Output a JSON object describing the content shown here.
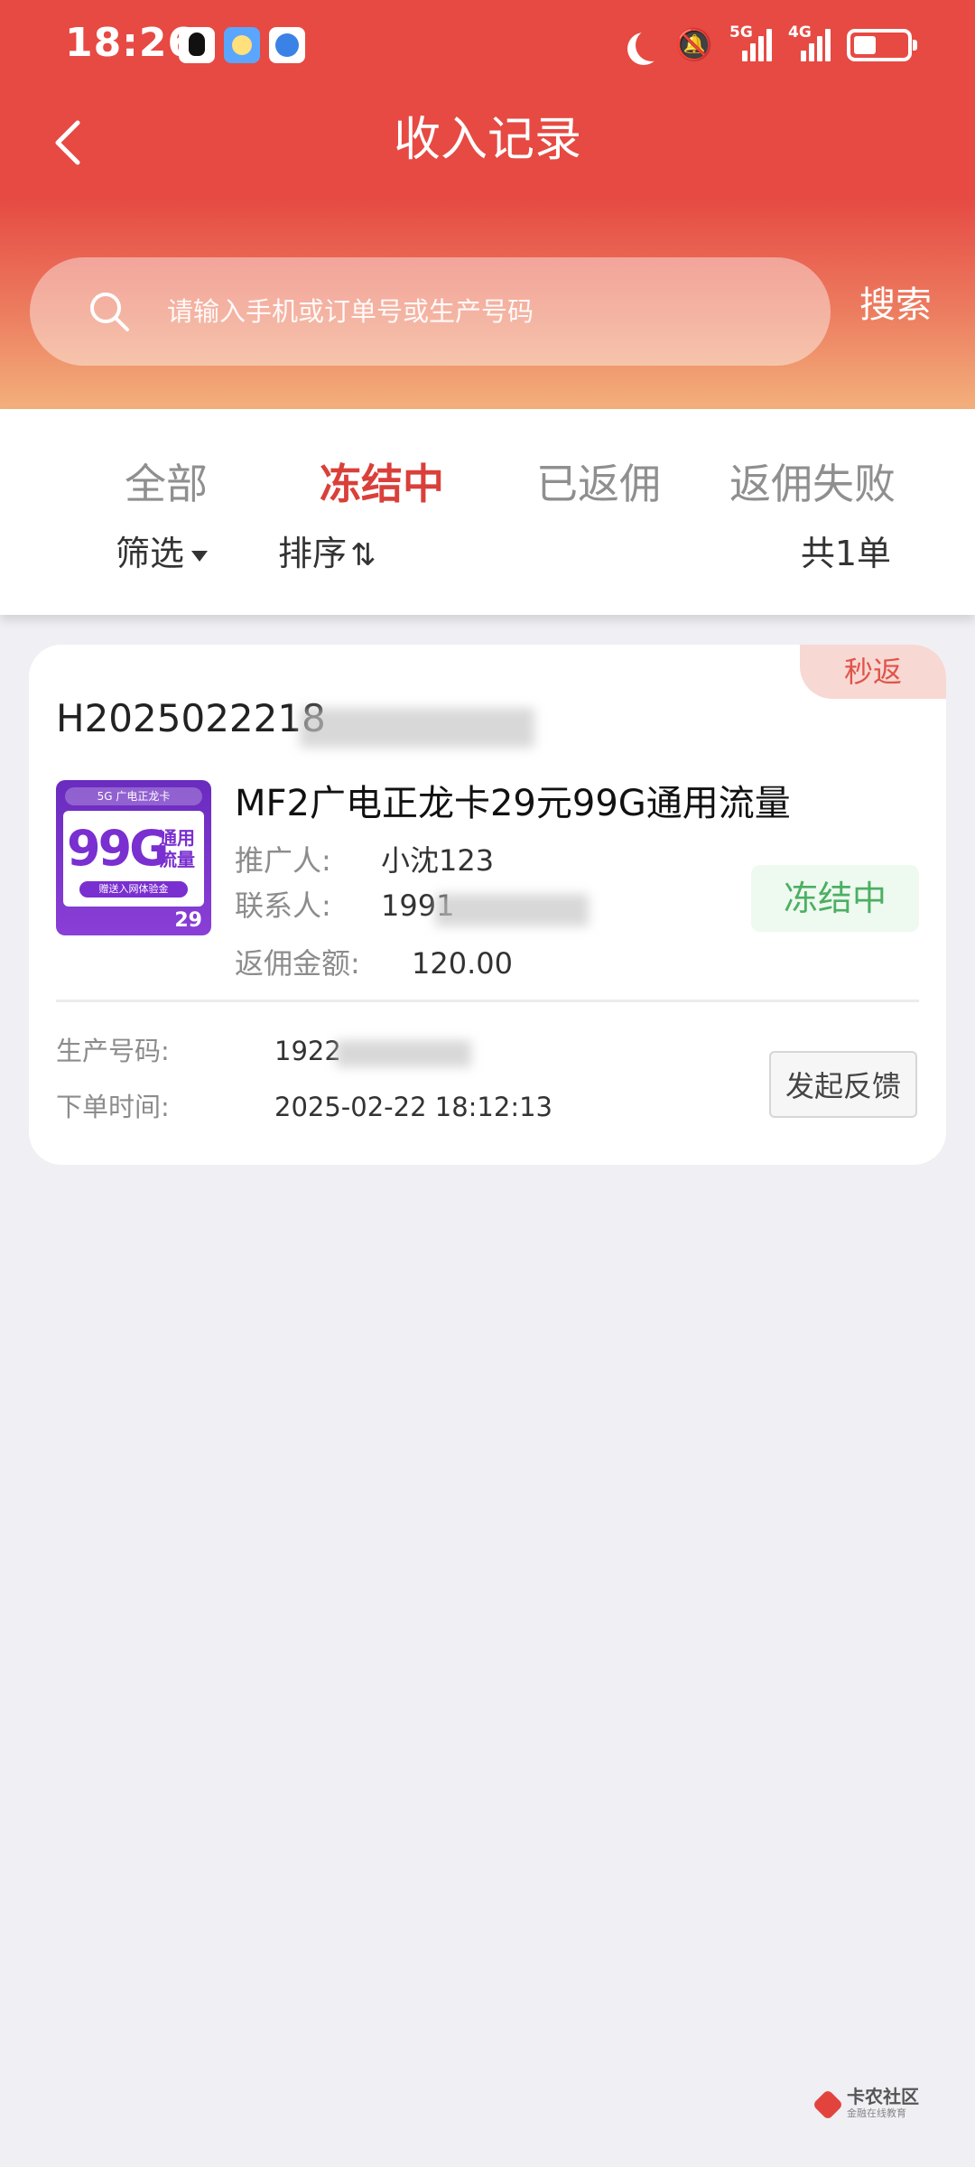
{
  "status_bar": {
    "time": "18:26",
    "network_5g": "5G",
    "network_4g": "4G",
    "icons": [
      "qq-icon",
      "weather-icon",
      "browser-icon",
      "moon-icon",
      "bell-off-icon",
      "signal-icon",
      "battery-icon"
    ]
  },
  "nav": {
    "title": "收入记录",
    "back_icon": "chevron-left-icon"
  },
  "search": {
    "placeholder": "请输入手机或订单号或生产号码",
    "value": "",
    "button_label": "搜索"
  },
  "tabs": [
    {
      "label": "全部",
      "active": false
    },
    {
      "label": "冻结中",
      "active": true
    },
    {
      "label": "已返佣",
      "active": false
    },
    {
      "label": "返佣失败",
      "active": false
    }
  ],
  "filters": {
    "filter_label": "筛选",
    "sort_label": "排序",
    "count_label": "共1单"
  },
  "order": {
    "badge": "秒返",
    "order_no": "H2025022218",
    "product_image": {
      "top_text": "5G 广电正龙卡",
      "big_text": "99G",
      "side_text": "通用流量",
      "sub_text": "赠送入网体验金",
      "price": "29"
    },
    "product_title": "MF2广电正龙卡29元99G通用流量",
    "promoter_label": "推广人:",
    "promoter_value": "小沈123",
    "contact_label": "联系人:",
    "contact_value": "1991",
    "commission_label": "返佣金额:",
    "commission_value": "120.00",
    "status": "冻结中",
    "production_label": "生产号码:",
    "production_value": "1922",
    "order_time_label": "下单时间:",
    "order_time_value": "2025-02-22 18:12:13",
    "feedback_button": "发起反馈"
  },
  "watermark": {
    "title": "卡农社区",
    "subtitle": "金融在线教育"
  },
  "colors": {
    "header_red": "#e64a43",
    "active_tab": "#d9403a",
    "status_green": "#4caf63",
    "badge_bg": "#f8d8d3",
    "page_bg": "#f0eff4"
  }
}
